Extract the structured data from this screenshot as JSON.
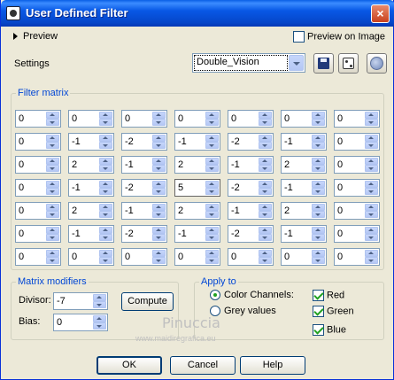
{
  "window": {
    "title": "User Defined Filter",
    "close_glyph": "×"
  },
  "preview": {
    "label": "Preview",
    "preview_on_image_label": "Preview on Image",
    "preview_on_image_checked": false
  },
  "settings": {
    "label": "Settings",
    "selected_value": "Double_Vision"
  },
  "matrix": {
    "label": "Filter matrix",
    "rows": [
      [
        "0",
        "0",
        "0",
        "0",
        "0",
        "0",
        "0"
      ],
      [
        "0",
        "-1",
        "-2",
        "-1",
        "-2",
        "-1",
        "0"
      ],
      [
        "0",
        "2",
        "-1",
        "2",
        "-1",
        "2",
        "0"
      ],
      [
        "0",
        "-1",
        "-2",
        "5",
        "-2",
        "-1",
        "0"
      ],
      [
        "0",
        "2",
        "-1",
        "2",
        "-1",
        "2",
        "0"
      ],
      [
        "0",
        "-1",
        "-2",
        "-1",
        "-2",
        "-1",
        "0"
      ],
      [
        "0",
        "0",
        "0",
        "0",
        "0",
        "0",
        "0"
      ]
    ]
  },
  "modifiers": {
    "label": "Matrix modifiers",
    "divisor_label": "Divisor:",
    "divisor_value": "-7",
    "bias_label": "Bias:",
    "bias_value": "0",
    "compute_label": "Compute"
  },
  "apply": {
    "label": "Apply to",
    "color_channels_label": "Color Channels:",
    "grey_values_label": "Grey values",
    "selected": "color_channels",
    "red_label": "Red",
    "green_label": "Green",
    "blue_label": "Blue",
    "red_checked": true,
    "green_checked": true,
    "blue_checked": true
  },
  "watermark": {
    "name": "Pinuccia",
    "url": "www.maidiregrafica.eu"
  },
  "buttons": {
    "ok": "OK",
    "cancel": "Cancel",
    "help": "Help"
  },
  "colors": {
    "title_bar": "#0858e5",
    "group_label": "#0046d5",
    "dialog_bg": "#ece9d8"
  }
}
